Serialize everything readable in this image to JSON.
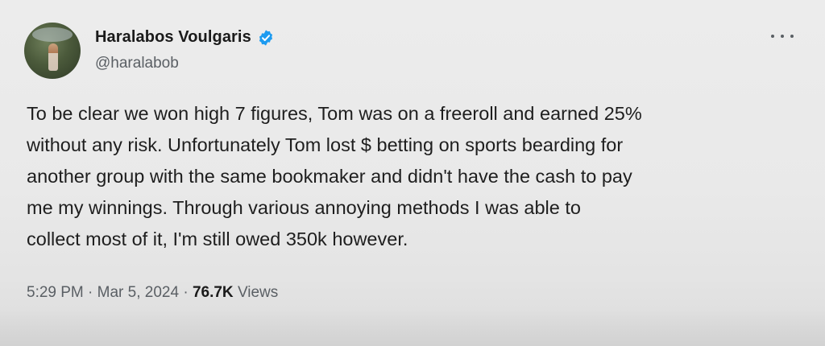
{
  "author": {
    "display_name": "Haralabos Voulgaris",
    "handle": "@haralabob",
    "verified_icon": "verified-badge-icon",
    "badge_color": "#1d9bf0"
  },
  "menu": {
    "icon": "more-horizontal-icon"
  },
  "tweet": {
    "lines": [
      "To be clear we won high 7 figures, Tom was on a freeroll and earned 25%",
      "without any risk. Unfortunately Tom lost $ betting on sports bearding for",
      "another group with the same bookmaker and didn't have the cash to pay",
      "me my winnings.  Through various annoying methods I was able to",
      "collect most of it, I'm still owed 350k however."
    ]
  },
  "meta": {
    "time": "5:29 PM",
    "separator": "·",
    "date": "Mar 5, 2024",
    "views_count": "76.7K",
    "views_label": "Views"
  }
}
